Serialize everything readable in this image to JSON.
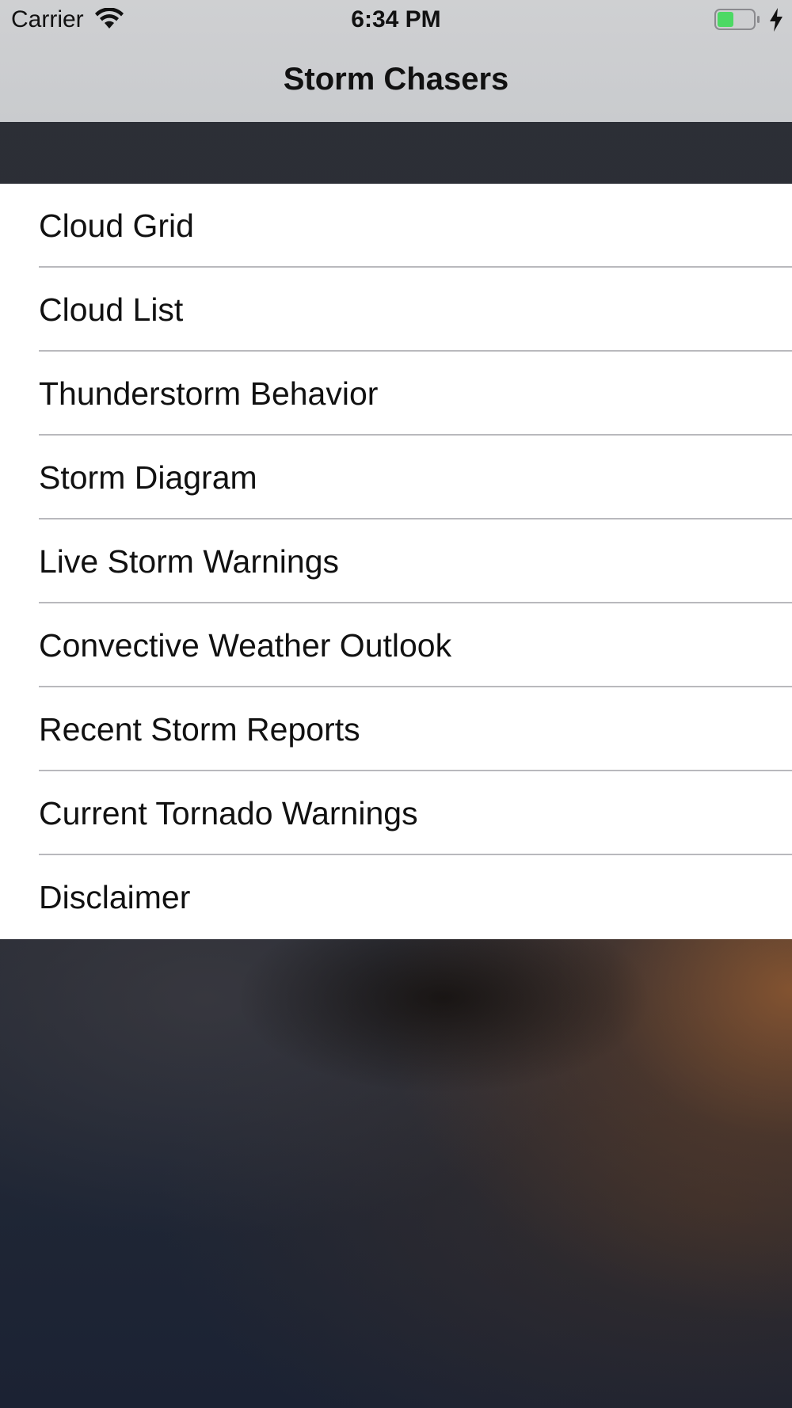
{
  "status_bar": {
    "carrier": "Carrier",
    "time": "6:34 PM",
    "battery_color": "#4cd964",
    "icons": [
      "wifi-icon",
      "battery-icon",
      "charging-bolt-icon"
    ]
  },
  "nav": {
    "title": "Storm Chasers"
  },
  "menu": {
    "items": [
      {
        "label": "Cloud Grid"
      },
      {
        "label": "Cloud List"
      },
      {
        "label": "Thunderstorm Behavior"
      },
      {
        "label": "Storm Diagram"
      },
      {
        "label": "Live Storm Warnings"
      },
      {
        "label": "Convective Weather Outlook"
      },
      {
        "label": "Recent Storm Reports"
      },
      {
        "label": "Current Tornado Warnings"
      },
      {
        "label": "Disclaimer"
      }
    ]
  }
}
